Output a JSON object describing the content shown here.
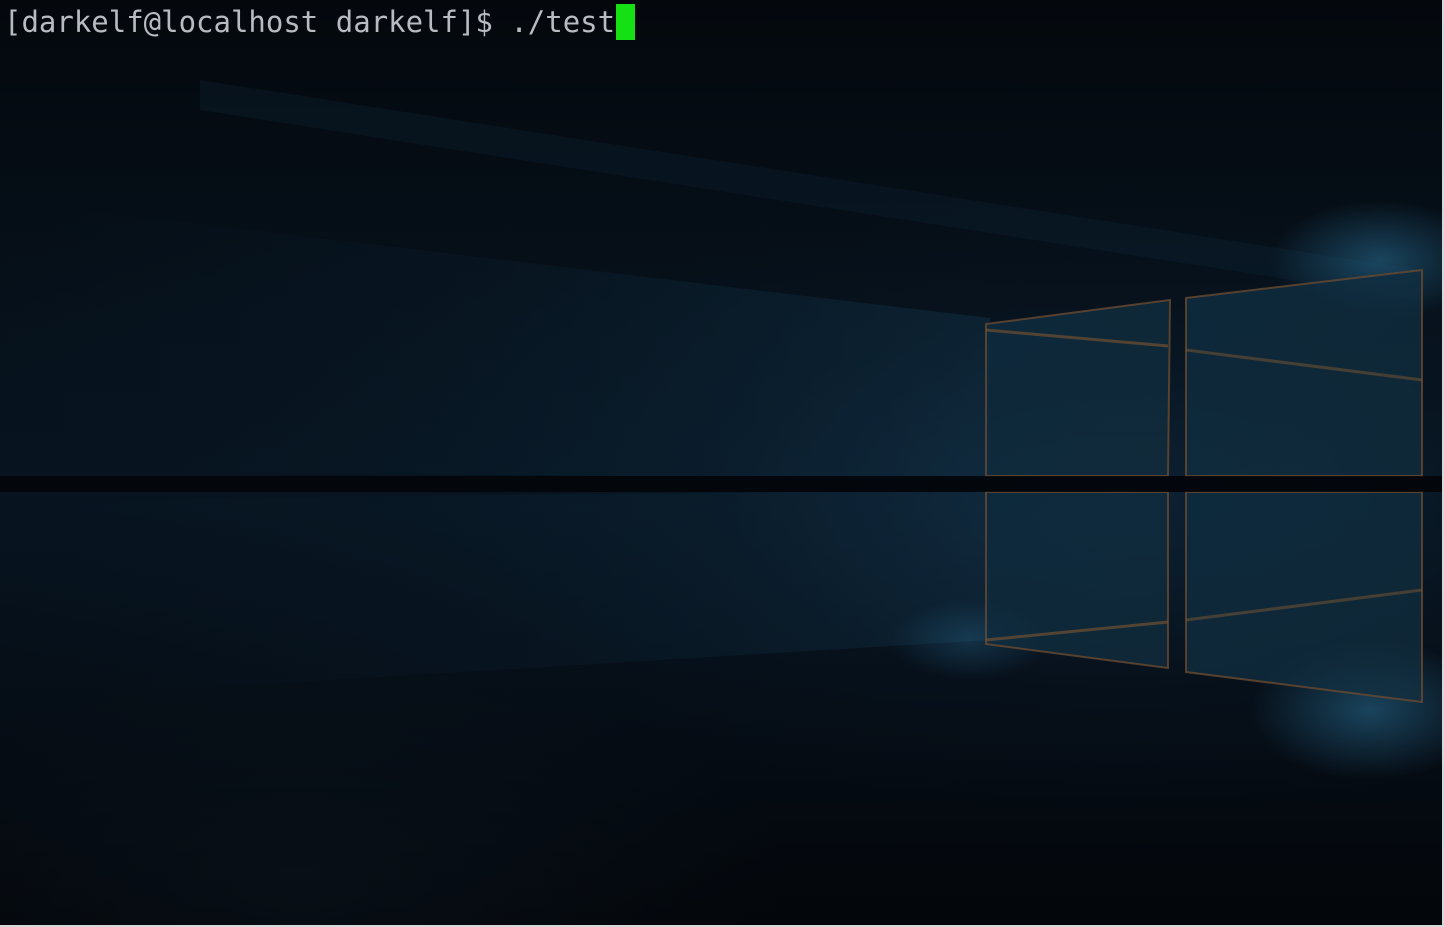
{
  "terminal": {
    "prompt": "[darkelf@localhost darkelf]$ ",
    "command": "./test",
    "cursor_color": "#14e014",
    "text_color": "#b8bcc2"
  },
  "wallpaper": {
    "description_icon": "windows-logo-light-icon",
    "accent_color": "#1b4a66",
    "edge_glow_color": "#b8763c"
  }
}
